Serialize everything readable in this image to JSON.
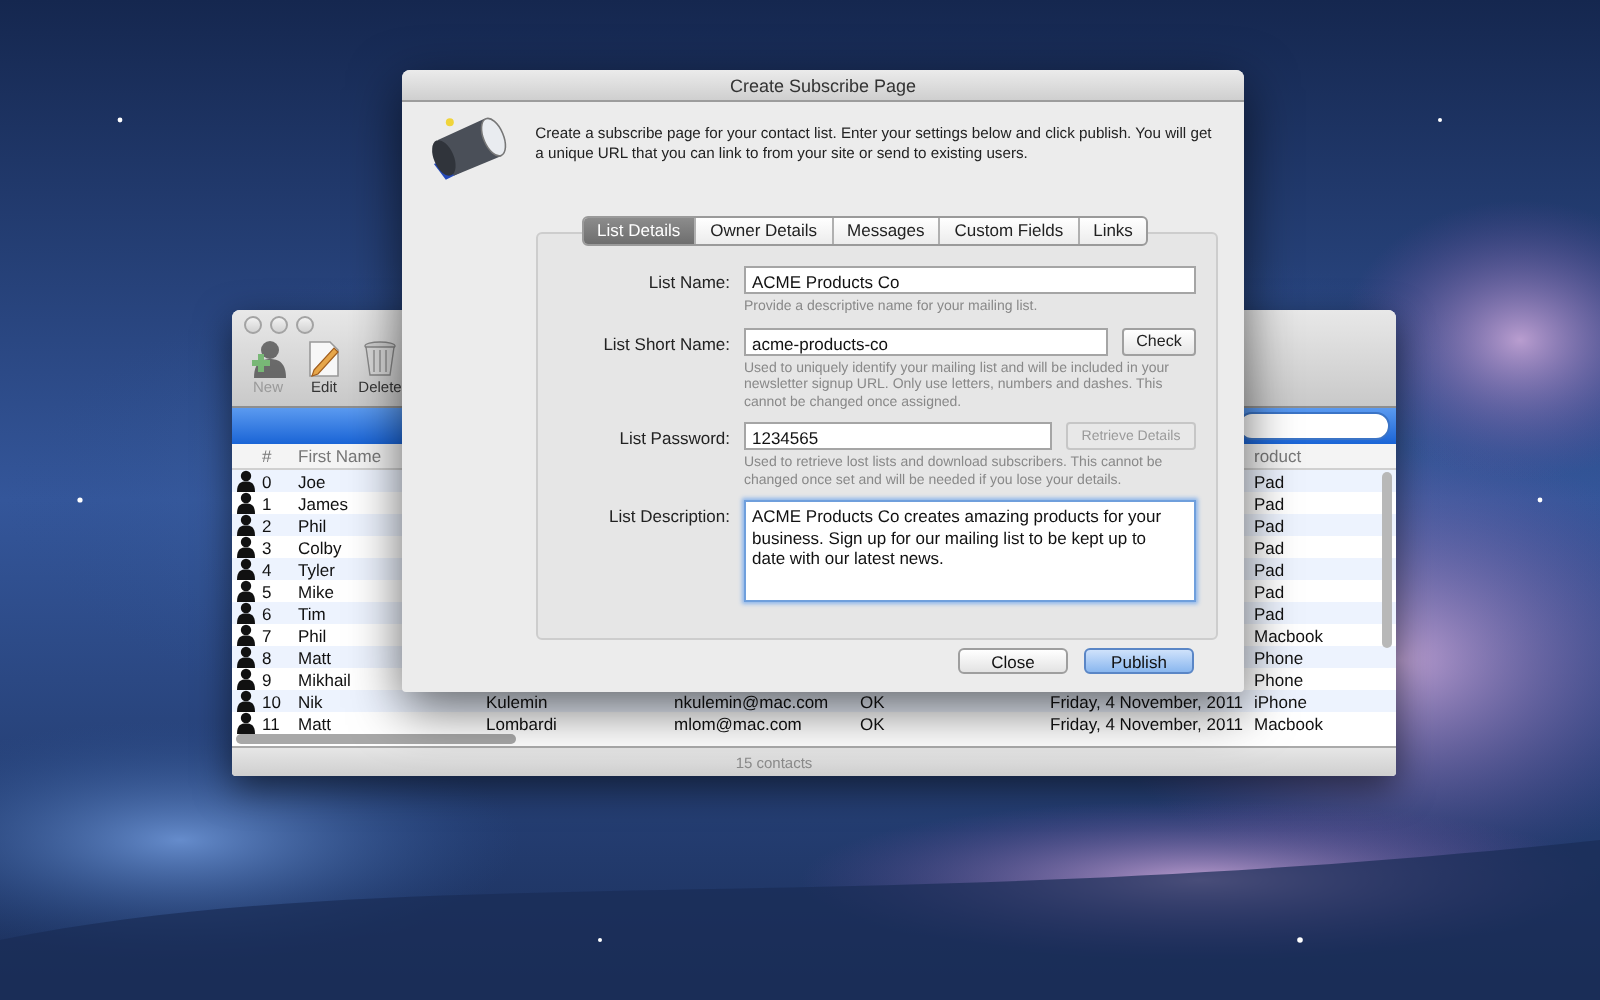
{
  "dialog": {
    "title": "Create Subscribe Page",
    "intro": "Create a subscribe page for your contact list. Enter your settings below and click publish. You will get a unique URL that you can link to from your site or send to existing users.",
    "tabs": [
      {
        "label": "List Details",
        "selected": true
      },
      {
        "label": "Owner Details",
        "selected": false
      },
      {
        "label": "Messages",
        "selected": false
      },
      {
        "label": "Custom Fields",
        "selected": false
      },
      {
        "label": "Links",
        "selected": false
      }
    ],
    "fields": [
      {
        "kind": "text",
        "label": "List Name:",
        "value": "ACME Products Co",
        "hint": "Provide a descriptive name for your mailing list."
      },
      {
        "kind": "text",
        "label": "List Short Name:",
        "value": "acme-products-co",
        "hint": "Used to uniquely identify your mailing list and will be included in your newsletter signup URL. Only use letters, numbers and dashes. This cannot be changed once assigned.",
        "button": {
          "label": "Check",
          "disabled": false
        }
      },
      {
        "kind": "text",
        "label": "List Password:",
        "value": "1234565",
        "hint": "Used to retrieve lost lists and download subscribers. This cannot be changed once set and will be needed if you lose your details.",
        "button": {
          "label": "Retrieve Details",
          "disabled": true
        }
      },
      {
        "kind": "textarea",
        "label": "List Description:",
        "value": "ACME Products Co creates amazing products for your business. Sign up for our mailing list to be kept up to date with our latest news."
      }
    ],
    "buttons": [
      {
        "label": "Close",
        "default": false
      },
      {
        "label": "Publish",
        "default": true
      }
    ]
  },
  "contacts_window": {
    "toolbar": [
      {
        "kind": "new",
        "label": "New",
        "disabled": true
      },
      {
        "kind": "edit",
        "label": "Edit",
        "disabled": false
      },
      {
        "kind": "delete",
        "label": "Delete",
        "disabled": false
      }
    ],
    "columns": [
      "#",
      "First Name",
      "roduct"
    ],
    "rows": [
      {
        "number": "0",
        "first_name": "Joe",
        "product": "Pad"
      },
      {
        "number": "1",
        "first_name": "James",
        "product": "Pad"
      },
      {
        "number": "2",
        "first_name": "Phil",
        "product": "Pad"
      },
      {
        "number": "3",
        "first_name": "Colby",
        "product": "Pad"
      },
      {
        "number": "4",
        "first_name": "Tyler",
        "product": "Pad"
      },
      {
        "number": "5",
        "first_name": "Mike",
        "product": "Pad"
      },
      {
        "number": "6",
        "first_name": "Tim",
        "product": "Pad"
      },
      {
        "number": "7",
        "first_name": "Phil",
        "product": "Macbook"
      },
      {
        "number": "8",
        "first_name": "Matt",
        "product": "Phone"
      },
      {
        "number": "9",
        "first_name": "Mikhail",
        "product": "Phone"
      },
      {
        "number": "10",
        "first_name": "Nik",
        "last_name": "Kulemin",
        "email": "nkulemin@mac.com",
        "status": "OK",
        "date": "Friday, 4 November, 2011",
        "product": "iPhone"
      },
      {
        "number": "11",
        "first_name": "Matt",
        "last_name": "Lombardi",
        "email": "mlom@mac.com",
        "status": "OK",
        "date": "Friday, 4 November, 2011",
        "product": "Macbook"
      }
    ],
    "status": "15 contacts"
  }
}
